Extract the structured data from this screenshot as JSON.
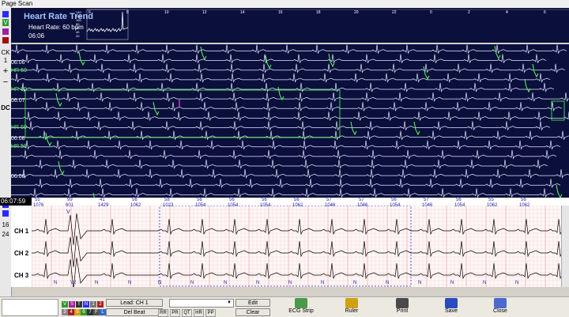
{
  "window": {
    "title": "Page Scan"
  },
  "left_panel": {
    "v": "V",
    "ck": "CK",
    "one": "1",
    "plus": "+",
    "minus": "−",
    "dc": "DC",
    "sixteen": "16",
    "twenty_four": "24"
  },
  "trend": {
    "title": "Heart Rate Trend",
    "hr": "Heart Rate: 60 bpm",
    "time": "06:06",
    "y_ticks": [
      "140",
      "120",
      "100",
      "80",
      "60",
      "40",
      "20"
    ],
    "x_ticks": [
      "6",
      "8",
      "10",
      "12",
      "14",
      "16",
      "18",
      "20",
      "22",
      "0",
      "2",
      "4",
      "6"
    ]
  },
  "overview": {
    "rows": [
      {
        "time": "06:06",
        "hr": "HR 60"
      },
      {
        "time": "",
        "hr": "HR 60"
      },
      {
        "time": "06:07",
        "hr": ""
      },
      {
        "time": "",
        "hr": "HR 60"
      },
      {
        "time": "06:08",
        "hr": "HR 58"
      },
      {
        "time": "",
        "hr": ""
      },
      {
        "time": "06:09",
        "hr": ""
      },
      {
        "time": "",
        "hr": "HR 58"
      }
    ]
  },
  "detail": {
    "time": "06:07:59",
    "beats": [
      {
        "hr": "55",
        "rr": "1076"
      },
      {
        "hr": "99",
        "rr": "601"
      },
      {
        "hr": "41",
        "rr": "1429"
      },
      {
        "hr": "56",
        "rr": "1062"
      },
      {
        "hr": "58",
        "rr": "1023"
      },
      {
        "hr": "56",
        "rr": "1054"
      },
      {
        "hr": "56",
        "rr": "1054"
      },
      {
        "hr": "56",
        "rr": "1054"
      },
      {
        "hr": "56",
        "rr": "1062"
      },
      {
        "hr": "57",
        "rr": "1046"
      },
      {
        "hr": "57",
        "rr": "1046"
      },
      {
        "hr": "56",
        "rr": "1054"
      },
      {
        "hr": "57",
        "rr": "1046"
      },
      {
        "hr": "56",
        "rr": "1054"
      },
      {
        "hr": "55",
        "rr": "1062"
      },
      {
        "hr": "56",
        "rr": "1062"
      }
    ],
    "annot_top": "V",
    "labels_bottom": [
      "N",
      "V2",
      "N",
      "N",
      "N",
      "N",
      "N",
      "N",
      "N",
      "N",
      "N",
      "N",
      "N",
      "N",
      "N",
      "N"
    ],
    "channels": [
      "CH 1",
      "CH 2",
      "CH 3"
    ]
  },
  "toolbar": {
    "lead_label": "Lead: CH 1",
    "del_beat": "Del Beat",
    "edit": "Edit",
    "clear": "Clear",
    "measures": [
      "RR",
      "PR",
      "QT",
      "HR",
      "PP"
    ],
    "tools": [
      {
        "label": "ECG Strip",
        "icon": "ecg-strip-icon"
      },
      {
        "label": "Ruler",
        "icon": "ruler-icon"
      },
      {
        "label": "Print",
        "icon": "print-icon"
      },
      {
        "label": "Save",
        "icon": "save-icon"
      },
      {
        "label": "Close",
        "icon": "close-icon"
      }
    ],
    "mini_top": [
      "V",
      "S",
      "T",
      "N",
      "1",
      "2"
    ],
    "mini_bottom": [
      "3",
      "4",
      "5",
      "6",
      "7",
      "F",
      "L"
    ]
  },
  "colors": {
    "dark_bg": "#0a0f3c",
    "trace": "#e6e6ff",
    "highlight": "#56ff56",
    "beat_marker": "#3a3aff"
  }
}
